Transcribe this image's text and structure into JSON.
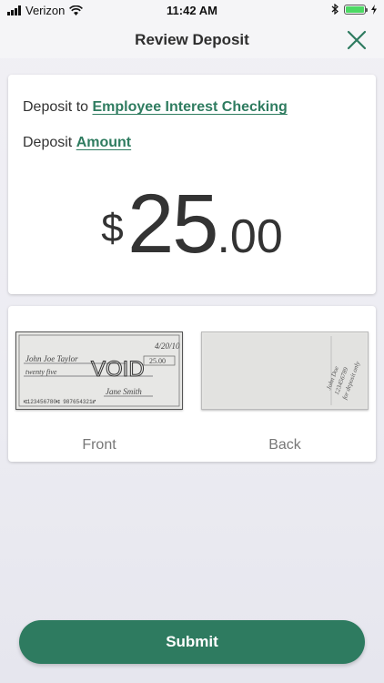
{
  "status_bar": {
    "carrier": "Verizon",
    "time": "11:42 AM"
  },
  "nav": {
    "title": "Review Deposit",
    "close_icon": "close-x-icon"
  },
  "deposit": {
    "to_label": "Deposit to",
    "account": "Employee Interest Checking",
    "amount_label": "Deposit",
    "amount_link": "Amount",
    "currency": "$",
    "amount_whole": "25",
    "amount_cents": ".00"
  },
  "check_images": {
    "front_label": "Front",
    "back_label": "Back",
    "front_stamp": "VOID"
  },
  "submit": {
    "label": "Submit"
  },
  "colors": {
    "accent": "#2e7b60",
    "link": "#2f7c60",
    "battery": "#4cd964"
  }
}
